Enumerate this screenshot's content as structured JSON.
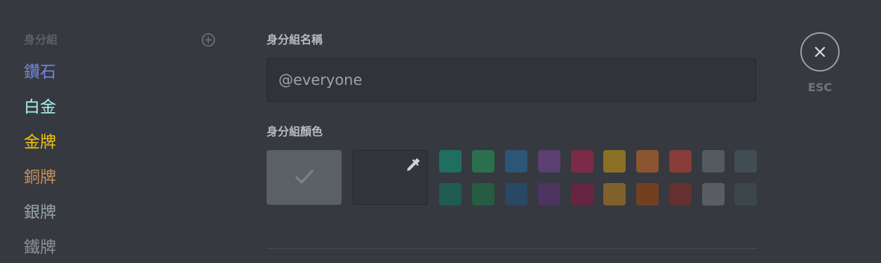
{
  "sidebar": {
    "title": "身分組",
    "add_icon": "plus-circle-icon",
    "roles": [
      {
        "label": "鑽石",
        "color": "#7289da"
      },
      {
        "label": "白金",
        "color": "#a7f3f0"
      },
      {
        "label": "金牌",
        "color": "#f1c40f"
      },
      {
        "label": "銅牌",
        "color": "#c7905e"
      },
      {
        "label": "銀牌",
        "color": "#95a5a6"
      },
      {
        "label": "鐵牌",
        "color": "#8f9295"
      }
    ]
  },
  "main": {
    "role_name_label": "身分組名稱",
    "role_name_value": "@everyone",
    "role_color_label": "身分組顏色",
    "default_color": "#5b5f66",
    "selected_icon": "checkmark-icon",
    "custom_color_icon": "eyedropper-icon",
    "palette_row_1": [
      "#1e6e62",
      "#2b6f4f",
      "#2d5576",
      "#5c3f71",
      "#7b2b47",
      "#8b7125",
      "#8a5530",
      "#873c38",
      "#545a5d",
      "#424d53"
    ],
    "palette_row_2": [
      "#1f5b52",
      "#265c42",
      "#284864",
      "#4d3460",
      "#672541",
      "#80612b",
      "#73401f",
      "#643030",
      "#5a5d62",
      "#3d464b"
    ]
  },
  "close": {
    "icon": "close-icon",
    "label": "ESC"
  }
}
